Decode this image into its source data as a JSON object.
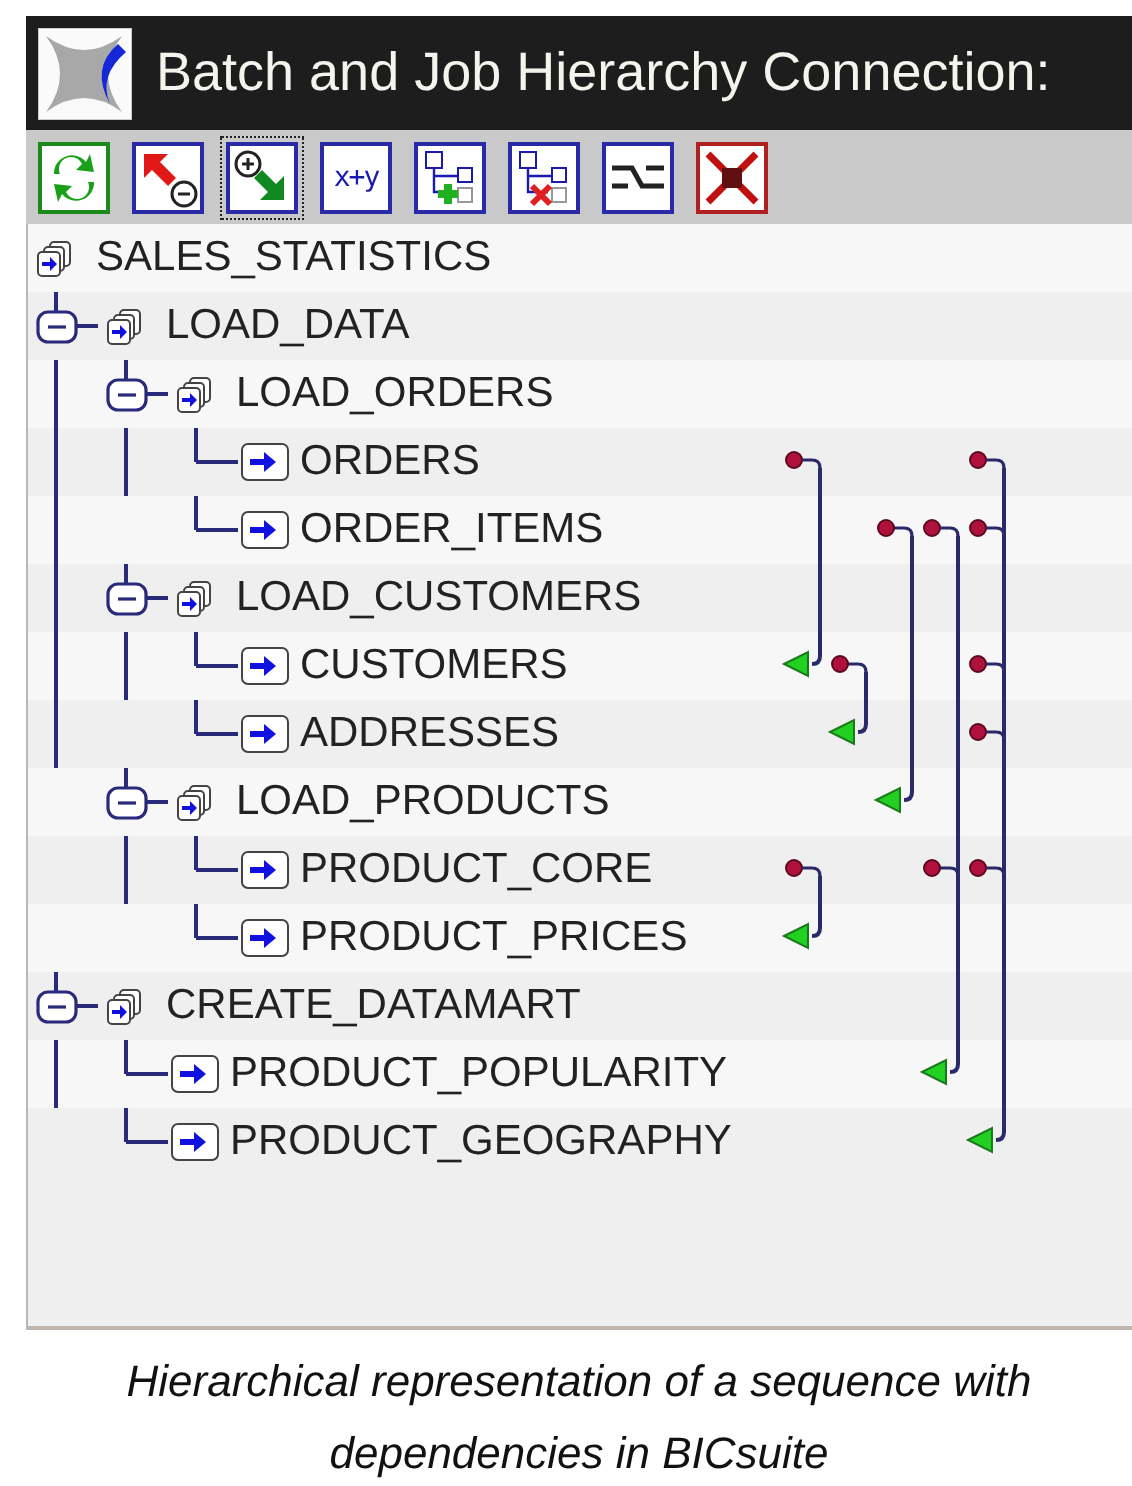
{
  "window": {
    "title": "Batch and Job Hierarchy Connection:"
  },
  "toolbar": [
    {
      "kind": "refresh",
      "focused": false
    },
    {
      "kind": "collapse",
      "focused": false
    },
    {
      "kind": "expand",
      "focused": true
    },
    {
      "kind": "formula",
      "label": "x+y",
      "focused": false
    },
    {
      "kind": "add-node",
      "focused": false
    },
    {
      "kind": "delete-node",
      "focused": false
    },
    {
      "kind": "connect",
      "focused": false
    },
    {
      "kind": "disconnect",
      "focused": false
    }
  ],
  "tree": {
    "root": {
      "name": "SALES_STATISTICS",
      "kind": "batch",
      "children": [
        {
          "name": "LOAD_DATA",
          "kind": "batch",
          "expanded": true,
          "children": [
            {
              "name": "LOAD_ORDERS",
              "kind": "batch",
              "expanded": true,
              "children": [
                {
                  "name": "ORDERS",
                  "kind": "job",
                  "dependency_lanes": [
                    {
                      "kind": "required"
                    },
                    {
                      "kind": "none"
                    },
                    {
                      "kind": "none"
                    },
                    {
                      "kind": "none"
                    },
                    {
                      "kind": "none"
                    },
                    {
                      "kind": "required"
                    }
                  ]
                },
                {
                  "name": "ORDER_ITEMS",
                  "kind": "job",
                  "dependency_lanes": [
                    {
                      "kind": "none"
                    },
                    {
                      "kind": "none"
                    },
                    {
                      "kind": "required"
                    },
                    {
                      "kind": "required"
                    },
                    {
                      "kind": "none"
                    },
                    {
                      "kind": "required"
                    }
                  ]
                }
              ]
            },
            {
              "name": "LOAD_CUSTOMERS",
              "kind": "batch",
              "expanded": true,
              "children": [
                {
                  "name": "CUSTOMERS",
                  "kind": "job",
                  "dependency_lanes": [
                    {
                      "kind": "dependent"
                    },
                    {
                      "kind": "required"
                    },
                    {
                      "kind": "none"
                    },
                    {
                      "kind": "none"
                    },
                    {
                      "kind": "none"
                    },
                    {
                      "kind": "required"
                    }
                  ]
                },
                {
                  "name": "ADDRESSES",
                  "kind": "job",
                  "dependency_lanes": [
                    {
                      "kind": "none"
                    },
                    {
                      "kind": "dependent"
                    },
                    {
                      "kind": "none"
                    },
                    {
                      "kind": "none"
                    },
                    {
                      "kind": "none"
                    },
                    {
                      "kind": "required"
                    }
                  ]
                }
              ]
            },
            {
              "name": "LOAD_PRODUCTS",
              "kind": "batch",
              "expanded": true,
              "dependency_lanes": [
                {
                  "kind": "none"
                },
                {
                  "kind": "none"
                },
                {
                  "kind": "dependent"
                },
                {
                  "kind": "none"
                },
                {
                  "kind": "none"
                },
                {
                  "kind": "none"
                }
              ],
              "children": [
                {
                  "name": "PRODUCT_CORE",
                  "kind": "job",
                  "dependency_lanes": [
                    {
                      "kind": "none"
                    },
                    {
                      "kind": "none"
                    },
                    {
                      "kind": "none"
                    },
                    {
                      "kind": "required"
                    },
                    {
                      "kind": "required"
                    },
                    {
                      "kind": "required"
                    }
                  ]
                },
                {
                  "name": "PRODUCT_PRICES",
                  "kind": "job",
                  "dependency_lanes": [
                    {
                      "kind": "none"
                    },
                    {
                      "kind": "none"
                    },
                    {
                      "kind": "none"
                    },
                    {
                      "kind": "none"
                    },
                    {
                      "kind": "dependent"
                    },
                    {
                      "kind": "none"
                    }
                  ]
                }
              ]
            }
          ]
        },
        {
          "name": "CREATE_DATAMART",
          "kind": "batch",
          "expanded": true,
          "children": [
            {
              "name": "PRODUCT_POPULARITY",
              "kind": "job",
              "dependency_lanes": [
                {
                  "kind": "none"
                },
                {
                  "kind": "none"
                },
                {
                  "kind": "none"
                },
                {
                  "kind": "dependent"
                },
                {
                  "kind": "none"
                },
                {
                  "kind": "none"
                }
              ]
            },
            {
              "name": "PRODUCT_GEOGRAPHY",
              "kind": "job",
              "dependency_lanes": [
                {
                  "kind": "none"
                },
                {
                  "kind": "none"
                },
                {
                  "kind": "none"
                },
                {
                  "kind": "none"
                },
                {
                  "kind": "none"
                },
                {
                  "kind": "dependent"
                }
              ]
            }
          ]
        }
      ]
    }
  },
  "caption": "Hierarchical representation of a sequence with dependencies in BICsuite"
}
